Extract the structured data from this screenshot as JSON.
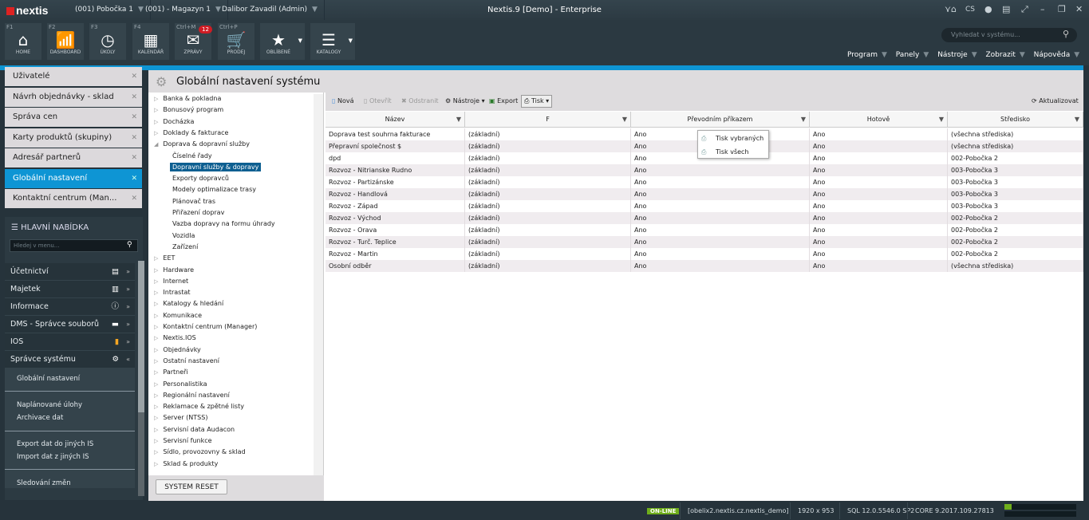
{
  "app": {
    "logo": "nextis",
    "title": "Nextis.9 [Demo] - Enterprise",
    "lang": "CS"
  },
  "context": [
    "(001) Pobočka 1",
    "(001) - Magazyn 1",
    "Dalibor Zavadil (Admin)"
  ],
  "toolbar": [
    {
      "key": "F1",
      "label": "HOME",
      "icon": "home-icon"
    },
    {
      "key": "F2",
      "label": "DASHBOARD",
      "icon": "chart-icon"
    },
    {
      "key": "F3",
      "label": "ÚKOLY",
      "icon": "clock-icon"
    },
    {
      "key": "F4",
      "label": "KALENDÁŘ",
      "icon": "calendar-icon"
    },
    {
      "key": "Ctrl+M",
      "label": "ZPRÁVY",
      "icon": "mail-icon",
      "badge": "12"
    },
    {
      "key": "Ctrl+P",
      "label": "PRODEJ",
      "icon": "cart-icon"
    },
    {
      "key": "",
      "label": "OBLÍBENÉ",
      "icon": "star-icon"
    },
    {
      "key": "",
      "label": "KATALOGY",
      "icon": "catalog-icon"
    }
  ],
  "search": {
    "placeholder": "Vyhledat v systému..."
  },
  "menu": [
    "Program",
    "Panely",
    "Nástroje",
    "Zobrazit",
    "Nápověda"
  ],
  "tabs": [
    "Uživatelé",
    "Návrh objednávky - sklad",
    "Správa cen",
    "Karty produktů (skupiny)",
    "Adresář partnerů",
    "Globální nastavení",
    "Kontaktní centrum (Man..."
  ],
  "mainmenu": {
    "title": "HLAVNÍ NABÍDKA",
    "search_placeholder": "Hledej v menu...",
    "items": [
      "Účetnictví",
      "Majetek",
      "Informace",
      "DMS - Správce souborů",
      "IOS",
      "Správce systému"
    ],
    "sub": [
      "Globální nastavení",
      "Naplánované úlohy",
      "Archivace dat",
      "Export dat do jiných IS",
      "Import dat z jiných IS",
      "Sledování změn"
    ]
  },
  "page": {
    "title": "Globální nastavení systému",
    "reset": "SYSTEM RESET"
  },
  "tree": {
    "before": [
      "Banka & pokladna",
      "Bonusový program",
      "Docházka",
      "Doklady & fakturace",
      "Doprava & dopravní služby"
    ],
    "children": [
      "Číselné řady",
      "Dopravní služby & dopravy",
      "Exporty dopravců",
      "Modely optimalizace trasy",
      "Plánovač tras",
      "Přiřazení doprav",
      "Vazba dopravy na formu úhrady",
      "Vozidla",
      "Zařízení"
    ],
    "after": [
      "EET",
      "Hardware",
      "Internet",
      "Intrastat",
      "Katalogy & hledání",
      "Komunikace",
      "Kontaktní centrum (Manager)",
      "Nextis.IOS",
      "Objednávky",
      "Ostatní nastavení",
      "Partneři",
      "Personalistika",
      "Regionální nastavení",
      "Reklamace & zpětné listy",
      "Server (NTSS)",
      "Servisní data Audacon",
      "Servisní funkce",
      "Sídlo, provozovny & sklad",
      "Sklad & produkty"
    ],
    "selected": "Dopravní služby & dopravy"
  },
  "grid": {
    "toolbar": {
      "new": "Nová",
      "open": "Otevřít",
      "delete": "Odstranit",
      "tools": "Nástroje",
      "export": "Export",
      "print": "Tisk",
      "refresh": "Aktualizovat"
    },
    "print_menu": [
      "Tisk vybraných",
      "Tisk všech"
    ],
    "columns": [
      "Název",
      "F",
      "Převodním příkazem",
      "Hotově",
      "Středisko"
    ],
    "rows": [
      [
        "Doprava test souhrna fakturace",
        "(základní)",
        "Ano",
        "Ano",
        "(všechna střediska)"
      ],
      [
        "Přepravní společnost $",
        "(základní)",
        "Ano",
        "Ano",
        "(všechna střediska)"
      ],
      [
        "dpd",
        "(základní)",
        "Ano",
        "Ano",
        "002-Pobočka 2"
      ],
      [
        "Rozvoz - Nitrianske Rudno",
        "(základní)",
        "Ano",
        "Ano",
        "003-Pobočka 3"
      ],
      [
        "Rozvoz - Partizánske",
        "(základní)",
        "Ano",
        "Ano",
        "003-Pobočka 3"
      ],
      [
        "Rozvoz - Handlová",
        "(základní)",
        "Ano",
        "Ano",
        "003-Pobočka 3"
      ],
      [
        "Rozvoz - Západ",
        "(základní)",
        "Ano",
        "Ano",
        "003-Pobočka 3"
      ],
      [
        "Rozvoz - Východ",
        "(základní)",
        "Ano",
        "Ano",
        "002-Pobočka 2"
      ],
      [
        "Rozvoz - Orava",
        "(základní)",
        "Ano",
        "Ano",
        "002-Pobočka 2"
      ],
      [
        "Rozvoz - Turč. Teplice",
        "(základní)",
        "Ano",
        "Ano",
        "002-Pobočka 2"
      ],
      [
        "Rozvoz - Martin",
        "(základní)",
        "Ano",
        "Ano",
        "002-Pobočka 2"
      ],
      [
        "Osobní odběr",
        "(základní)",
        "Ano",
        "Ano",
        "(všechna střediska)"
      ]
    ]
  },
  "status": {
    "online": "ON-LINE",
    "server": "[obelix2.nextis.cz.nextis_demo]",
    "resolution": "1920 x 953",
    "sql": "SQL 12.0.5546.0 SP2",
    "core": "CORE 9.2017.109.27813",
    "load": 0.1
  },
  "colors": {
    "accent": "#0e95d4",
    "online": "#6fae1b",
    "badge": "#d01c24"
  }
}
